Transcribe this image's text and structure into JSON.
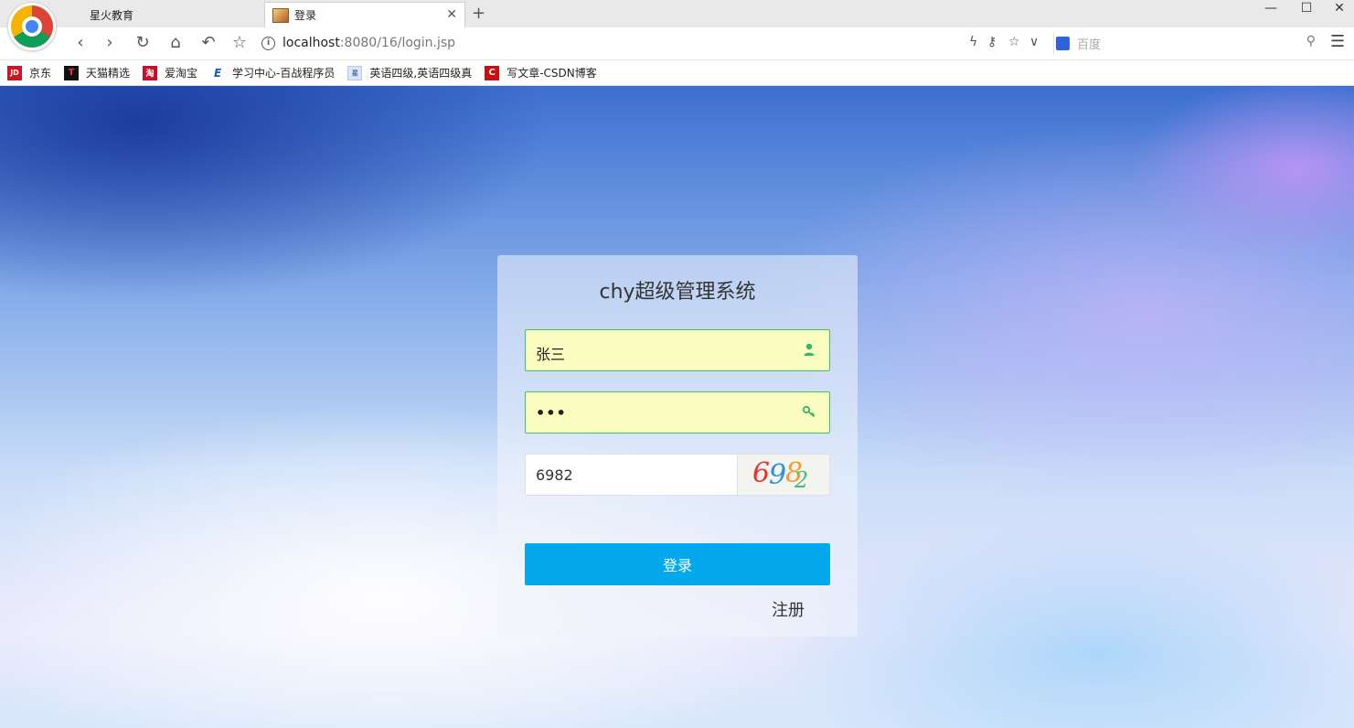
{
  "browser": {
    "tabs": [
      {
        "label": "星火教育"
      },
      {
        "label": "登录"
      }
    ],
    "address": {
      "host": "localhost",
      "path": ":8080/16/login.jsp"
    },
    "search_placeholder": "百度",
    "bookmarks": [
      {
        "label": "京东",
        "icon": "jd-icon",
        "color": "#c81623",
        "glyph": "JD"
      },
      {
        "label": "天猫精选",
        "icon": "tmall-icon",
        "color": "#111111",
        "glyph": "T"
      },
      {
        "label": "爱淘宝",
        "icon": "taobao-icon",
        "color": "#c8102e",
        "glyph": "淘"
      },
      {
        "label": "学习中心-百战程序员",
        "icon": "bzcxy-icon",
        "color": "#1a56c4",
        "glyph": "E"
      },
      {
        "label": "英语四级,英语四级真",
        "icon": "english-icon",
        "color": "#d8e6f8",
        "glyph": "星"
      },
      {
        "label": "写文章-CSDN博客",
        "icon": "csdn-icon",
        "color": "#c90f0f",
        "glyph": "C"
      }
    ]
  },
  "login": {
    "title": "chy超级管理系统",
    "username": "张三",
    "password_mask": "•••",
    "captcha_value": "6982",
    "captcha_chars": [
      {
        "ch": "6",
        "color": "#e0352b"
      },
      {
        "ch": "9",
        "color": "#2f8fd8"
      },
      {
        "ch": "8",
        "color": "#f0a030"
      },
      {
        "ch": "2",
        "color": "#3fc07a"
      }
    ],
    "submit_label": "登录",
    "register_label": "注册",
    "accent_color": "#03a9ec",
    "field_border_color": "#3cc26e"
  }
}
